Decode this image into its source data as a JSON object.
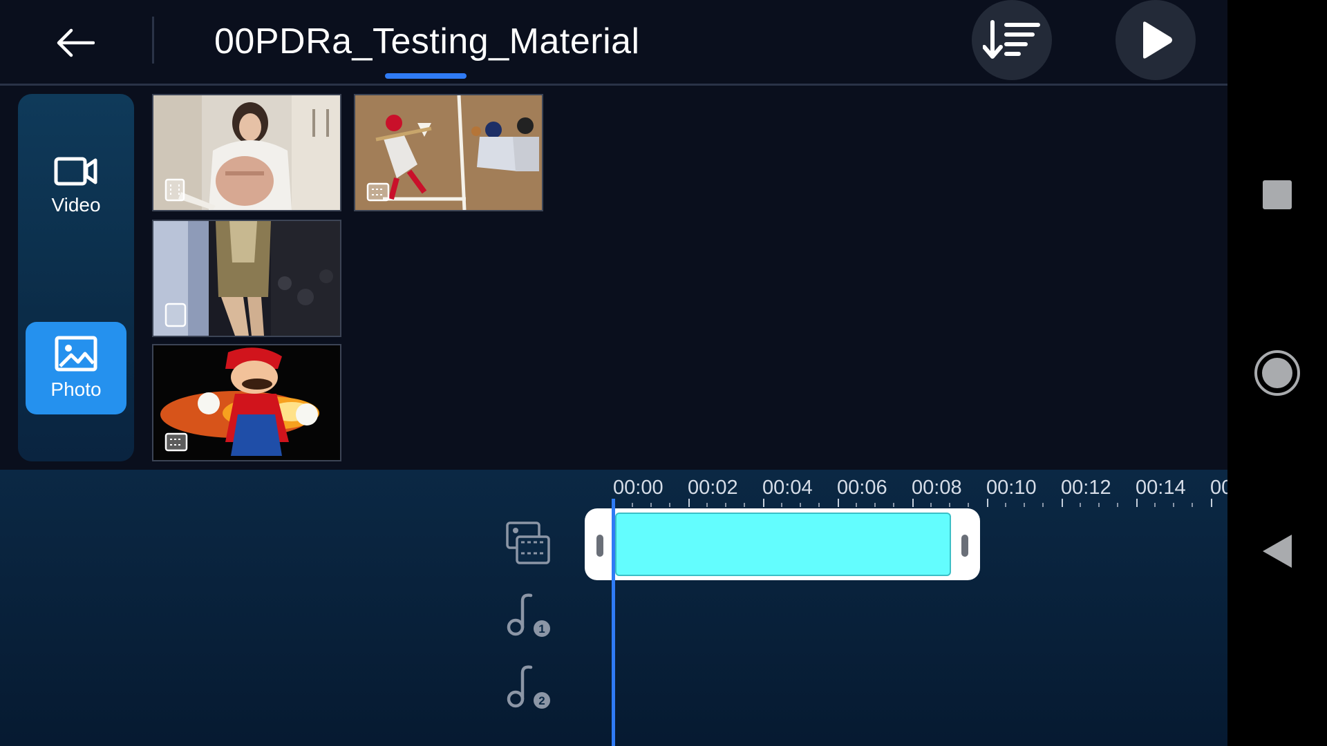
{
  "header": {
    "title": "00PDRa_Testing_Material",
    "icons": {
      "back": "back-arrow-icon",
      "sort": "sort-icon",
      "play": "play-icon"
    }
  },
  "tabs": [
    {
      "label": "Video",
      "icon": "video-camera-icon",
      "selected": false
    },
    {
      "label": "Photo",
      "icon": "photo-icon",
      "selected": true
    }
  ],
  "media": [
    {
      "kind": "image",
      "subject": "woman in white sweater with backpack"
    },
    {
      "kind": "image",
      "subject": "baseball batter, catcher and umpire"
    },
    {
      "kind": "image",
      "subject": "runway model in gold jacket"
    },
    {
      "kind": "image",
      "subject": "Mario with fireball"
    }
  ],
  "timeline": {
    "ticks": [
      "00:00",
      "00:02",
      "00:04",
      "00:06",
      "00:08",
      "00:10",
      "00:12",
      "00:14",
      "00"
    ],
    "tracks": [
      {
        "icon": "video-track-icon"
      },
      {
        "icon": "music-track-1-icon",
        "number": "1"
      },
      {
        "icon": "music-track-2-icon",
        "number": "2"
      }
    ]
  },
  "colors": {
    "accent": "#2f7bf5",
    "tab_selected": "#2591ee",
    "clip_fill": "#63fdfe",
    "background": "#0a0f1d",
    "timeline_bg": "#0b2844"
  },
  "system_nav": {
    "icons": [
      "recents-icon",
      "home-icon",
      "back-triangle-icon"
    ]
  }
}
